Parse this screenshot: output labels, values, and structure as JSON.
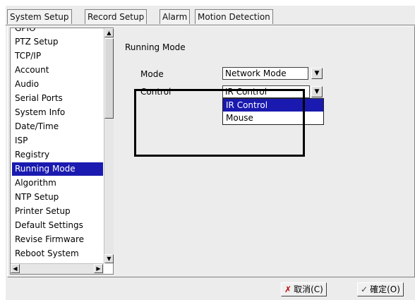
{
  "tabs": [
    "System Setup",
    "Record Setup",
    "Alarm",
    "Motion Detection"
  ],
  "sidebar": {
    "items": [
      {
        "label": "GPIO"
      },
      {
        "label": "PTZ Setup"
      },
      {
        "label": "TCP/IP"
      },
      {
        "label": "Account"
      },
      {
        "label": "Audio"
      },
      {
        "label": "Serial Ports"
      },
      {
        "label": "System Info"
      },
      {
        "label": "Date/Time"
      },
      {
        "label": "ISP"
      },
      {
        "label": "Registry"
      },
      {
        "label": "Running Mode"
      },
      {
        "label": "Algorithm"
      },
      {
        "label": "NTP Setup"
      },
      {
        "label": "Printer Setup"
      },
      {
        "label": "Default Settings"
      },
      {
        "label": "Revise Firmware"
      },
      {
        "label": "Reboot System"
      }
    ],
    "selected": "Running Mode"
  },
  "content": {
    "title": "Running Mode",
    "mode_label": "Mode",
    "mode_value": "Network Mode",
    "control_label": "Control",
    "control_value": "IR Control",
    "dropdown_options": [
      "IR Control",
      "Mouse"
    ],
    "dropdown_selected": "IR Control"
  },
  "footer": {
    "cancel_label": "取消(C)",
    "ok_label": "確定(O)"
  },
  "colors": {
    "selection": "#1a1ab0"
  }
}
